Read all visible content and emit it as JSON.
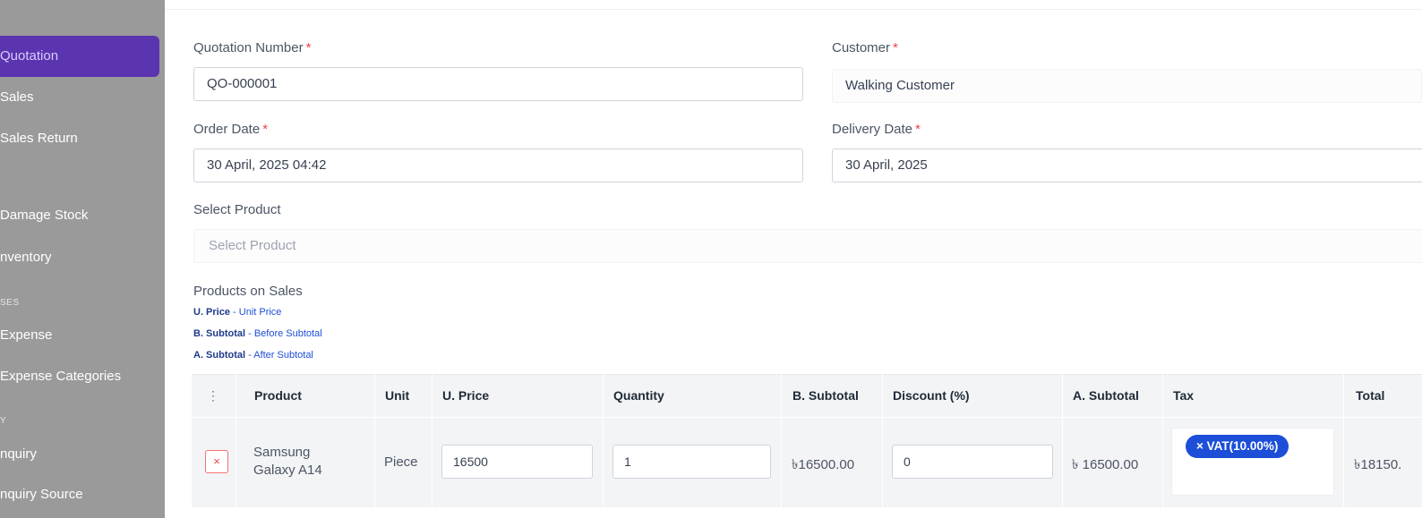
{
  "sidebar": {
    "items": [
      {
        "label": "Quotation",
        "active": true
      },
      {
        "label": "Sales"
      },
      {
        "label": "Sales Return"
      },
      {
        "label": "Damage Stock"
      },
      {
        "label": "nventory"
      },
      {
        "label": "Expense"
      },
      {
        "label": "Expense Categories"
      },
      {
        "label": "nquiry"
      },
      {
        "label": "nquiry Source"
      }
    ],
    "headings": [
      "SES",
      "Y"
    ]
  },
  "form": {
    "quotation_number": {
      "label": "Quotation Number",
      "value": "QO-000001"
    },
    "customer": {
      "label": "Customer",
      "value": "Walking Customer"
    },
    "order_date": {
      "label": "Order Date",
      "value": "30 April, 2025 04:42"
    },
    "delivery_date": {
      "label": "Delivery Date",
      "value": "30 April, 2025"
    },
    "select_product": {
      "label": "Select Product",
      "placeholder": "Select Product"
    },
    "required_mark": "*"
  },
  "products_section": {
    "title": "Products on Sales",
    "legend": [
      {
        "key": "U. Price",
        "desc": " - Unit Price"
      },
      {
        "key": "B. Subtotal",
        "desc": " - Before Subtotal"
      },
      {
        "key": "A. Subtotal",
        "desc": " - After Subtotal"
      }
    ]
  },
  "table": {
    "headers": [
      "⋮",
      "Product",
      "Unit",
      "U. Price",
      "Quantity",
      "B. Subtotal",
      "Discount (%)",
      "A. Subtotal",
      "Tax",
      "Total"
    ],
    "rows": [
      {
        "remove": "×",
        "product_line1": "Samsung",
        "product_line2": "Galaxy A14",
        "unit": "Piece",
        "unit_price": "16500",
        "quantity": "1",
        "before_subtotal": "৳16500.00",
        "discount": "0",
        "after_subtotal": "৳ 16500.00",
        "tax_chip": "× VAT(10.00%)",
        "total": "৳18150."
      }
    ]
  },
  "colors": {
    "sidebar_bg": "#9a9a9a",
    "active_item": "#5b34b0",
    "accent": "#1d4ed8",
    "required": "#ef4444"
  }
}
